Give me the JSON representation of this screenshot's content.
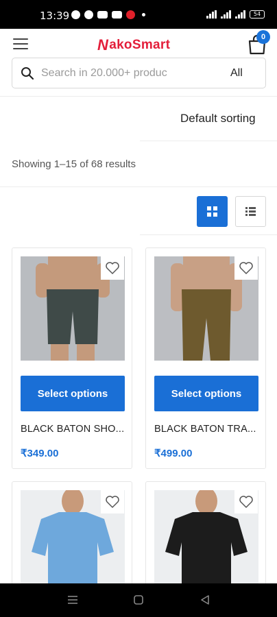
{
  "status_bar": {
    "time": "13:39",
    "battery": "54"
  },
  "header": {
    "logo_mark": "N",
    "logo_text": "akoSmart",
    "cart_count": "0"
  },
  "search": {
    "placeholder": "Search in 20.000+ produc",
    "category": "All"
  },
  "toolbar": {
    "sorting": "Default sorting",
    "results": "Showing 1–15 of 68 results"
  },
  "products": [
    {
      "name": "BLACK BATON SHO...",
      "price": "₹349.00",
      "button": "Select options"
    },
    {
      "name": "BLACK BATON TRA...",
      "price": "₹499.00",
      "button": "Select options"
    },
    {
      "name": "",
      "price": "",
      "button": ""
    },
    {
      "name": "",
      "price": "",
      "button": ""
    }
  ],
  "colors": {
    "accent": "#1a6fd6",
    "brand": "#e31e3a"
  }
}
